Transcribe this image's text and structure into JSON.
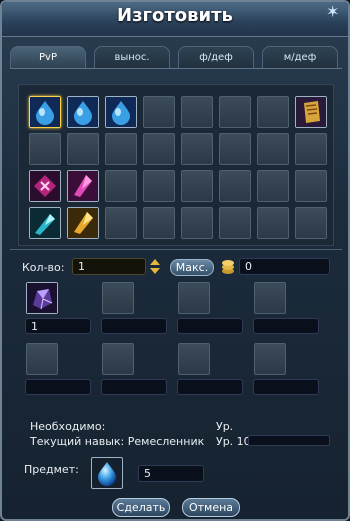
{
  "window": {
    "title": "Изготовить"
  },
  "tabs": [
    {
      "label": "PvP",
      "active": true
    },
    {
      "label": "вынос.",
      "active": false
    },
    {
      "label": "ф/деф",
      "active": false
    },
    {
      "label": "м/деф",
      "active": false
    }
  ],
  "inventory": {
    "rows": 4,
    "cols": 8,
    "items": [
      {
        "row": 0,
        "col": 0,
        "icon": "blue-drop-gem-icon",
        "selected": true
      },
      {
        "row": 0,
        "col": 1,
        "icon": "blue-drop-gem-icon"
      },
      {
        "row": 0,
        "col": 2,
        "icon": "blue-drop-gem-icon"
      },
      {
        "row": 0,
        "col": 7,
        "icon": "gold-scroll-icon"
      },
      {
        "row": 2,
        "col": 0,
        "icon": "purple-rune-icon"
      },
      {
        "row": 2,
        "col": 1,
        "icon": "pink-crystal-icon"
      },
      {
        "row": 3,
        "col": 0,
        "icon": "teal-crystal-icon"
      },
      {
        "row": 3,
        "col": 1,
        "icon": "gold-crystal-icon"
      }
    ]
  },
  "craft": {
    "qty_label": "Кол-во:",
    "qty_value": "1",
    "max_label": "Макс.",
    "coins_value": "0",
    "ingredients": [
      {
        "icon": "purple-ore-icon",
        "value": "1"
      },
      {
        "icon": "",
        "value": ""
      },
      {
        "icon": "",
        "value": ""
      },
      {
        "icon": "",
        "value": ""
      },
      {
        "icon": "",
        "value": ""
      },
      {
        "icon": "",
        "value": ""
      },
      {
        "icon": "",
        "value": ""
      },
      {
        "icon": "",
        "value": ""
      }
    ],
    "required_label": "Необходимо:",
    "required_level_label": "Ур.",
    "skill_label": "Текущий навык: Ремесленник",
    "skill_level_label": "Ур. 10",
    "item_label": "Предмет:",
    "item_icon": "blue-drop-gem-icon",
    "item_value": "5"
  },
  "buttons": {
    "make": "Сделать",
    "cancel": "Отмена"
  },
  "colors": {
    "accent": "#6c8aa5",
    "field_bg": "#0a0f1c",
    "window_border": "#6f8397"
  }
}
